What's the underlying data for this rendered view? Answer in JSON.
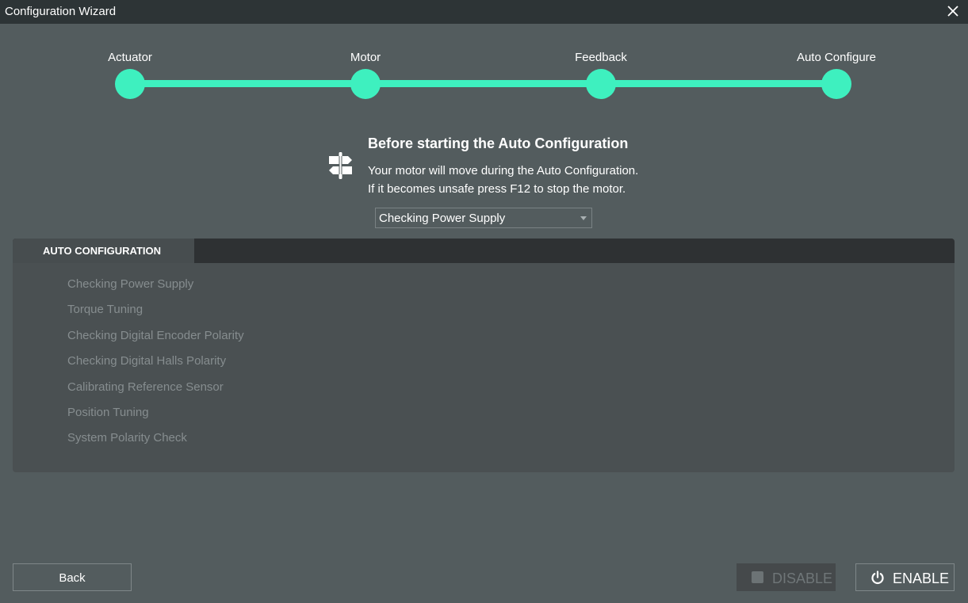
{
  "window": {
    "title": "Configuration Wizard",
    "close_icon": "close-icon"
  },
  "colors": {
    "accent": "#3ef0bf",
    "background": "#535c5e",
    "titlebar": "#2d3436",
    "panel": "#4a5052",
    "muted_text": "#868d8f"
  },
  "stepper": {
    "steps": [
      {
        "label": "Actuator"
      },
      {
        "label": "Motor"
      },
      {
        "label": "Feedback"
      },
      {
        "label": "Auto Configure"
      }
    ]
  },
  "notice": {
    "icon": "signpost-icon",
    "title": "Before starting the Auto Configuration",
    "line1": "Your motor will move during the Auto Configuration.",
    "line2": "If it becomes unsafe press F12 to stop the motor."
  },
  "step_select": {
    "value": "Checking Power Supply"
  },
  "panel": {
    "tab_label": "AUTO CONFIGURATION",
    "items": [
      "Checking Power Supply",
      "Torque Tuning",
      "Checking Digital Encoder Polarity",
      "Checking Digital Halls Polarity",
      "Calibrating Reference Sensor",
      "Position Tuning",
      "System Polarity Check"
    ]
  },
  "buttons": {
    "back": "Back",
    "disable": "DISABLE",
    "enable": "ENABLE",
    "enable_icon": "power-icon"
  }
}
